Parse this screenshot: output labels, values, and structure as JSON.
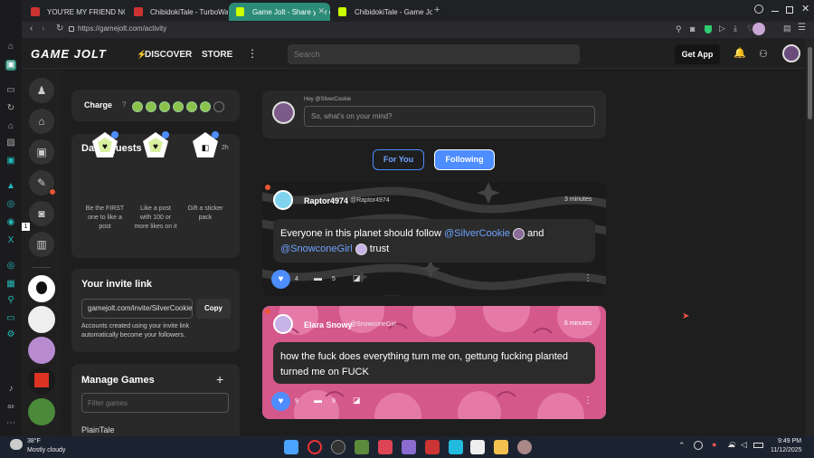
{
  "browser": {
    "tabs": [
      {
        "label": "YOU'RE MY FRIEND NOW",
        "active": false
      },
      {
        "label": "ChibidokiTale - TurboWarp",
        "active": false
      },
      {
        "label": "Game Jolt - Share your creations",
        "active": true
      },
      {
        "label": "ChibidokiTale - Game Jolt",
        "active": false
      }
    ],
    "url": "https://gamejolt.com/activity"
  },
  "header": {
    "logo": "GAME JOLT",
    "discover": "DISCOVER",
    "store": "STORE",
    "search_placeholder": "Search",
    "get_app": "Get App"
  },
  "charge": {
    "label": "Charge",
    "filled": 6,
    "total": 7
  },
  "quests": {
    "title": "Daily Quests",
    "timer": "2h",
    "items": [
      {
        "text": "Be the FIRST one to like a post"
      },
      {
        "text": "Like a post with 100 or more likes on it"
      },
      {
        "text": "Gift a sticker pack"
      }
    ]
  },
  "invite": {
    "title": "Your invite link",
    "link": "gamejolt.com/invite/SilverCookie",
    "copy": "Copy",
    "desc": "Accounts created using your invite link automatically become your followers."
  },
  "manage_games": {
    "title": "Manage Games",
    "filter_placeholder": "Filter games",
    "first_game": "PlainTale"
  },
  "composer": {
    "greeting": "Hey @SilverCookie",
    "placeholder": "So, what's on your mind?"
  },
  "feed_tabs": {
    "for_you": "For You",
    "following": "Following"
  },
  "posts": [
    {
      "name": "Raptor4974",
      "handle": "@Raptor4974",
      "time": "3 minutes",
      "text_a": "Everyone in this planet should follow ",
      "mention1": "@SilverCookie",
      "and": " and",
      "mention2": "@SnowconeGirl",
      "text_b": " trust",
      "likes": "4",
      "comments": "5"
    },
    {
      "name": "Elara Snowy",
      "handle": "@SnowconeGirl",
      "time": "6 minutes",
      "text": "how the fuck does everything turn me on, gettung fucking planted turned me on FUCK",
      "likes": "9",
      "comments": "9"
    }
  ],
  "taskbar": {
    "weather_temp": "38°F",
    "weather_desc": "Mostly cloudy",
    "time": "9:49 PM",
    "date": "11/12/2025"
  },
  "colors": {
    "accent_blue": "#4d8dff",
    "gj_green": "#2c8c78",
    "charge_green": "#8bc34a"
  }
}
